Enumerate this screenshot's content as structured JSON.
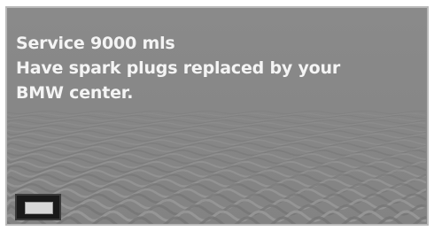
{
  "display": {
    "message_lines": [
      "Service 9000 mls",
      "Have spark plugs replaced by your",
      "BMW center."
    ],
    "confirm_button": {
      "label": ""
    }
  },
  "colors": {
    "background": "#868686",
    "text": "#f4f4f4",
    "button": "#1a1a1a",
    "frame": "#b9b9b9"
  }
}
